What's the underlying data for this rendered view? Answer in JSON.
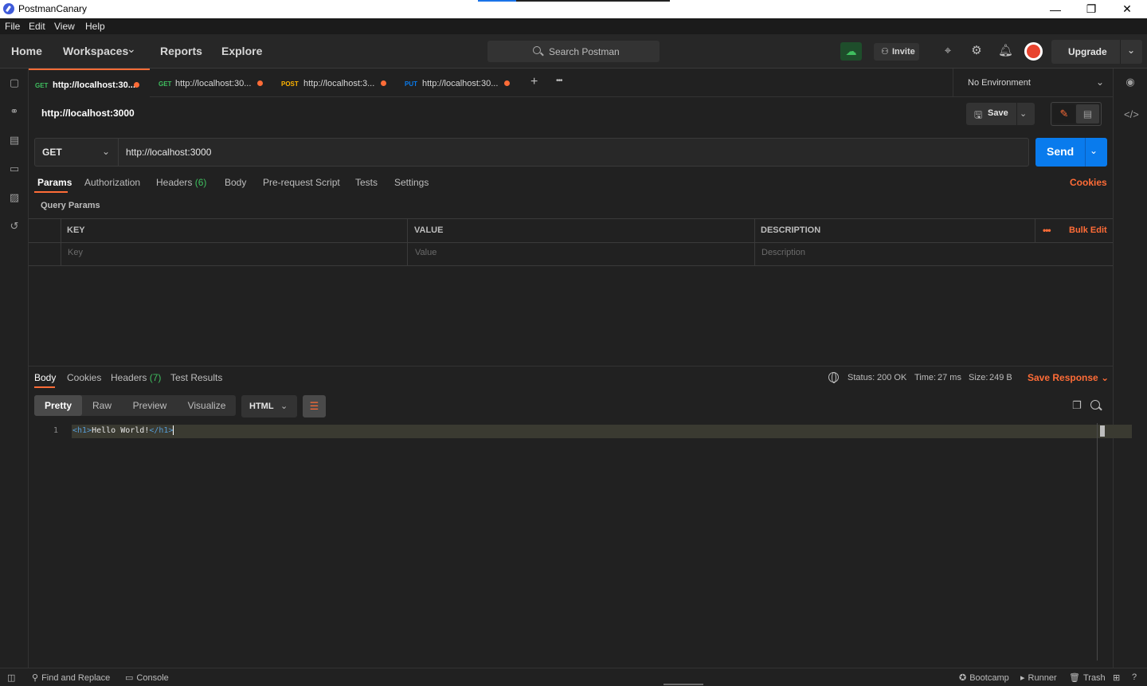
{
  "window": {
    "title": "PostmanCanary",
    "minimize": "—",
    "restore": "❐",
    "close": "✕"
  },
  "menu": [
    "File",
    "Edit",
    "View",
    "Help"
  ],
  "header": {
    "nav": [
      "Home",
      "Workspaces",
      "Reports",
      "Explore"
    ],
    "workspaces_chevron": "⌄",
    "search_placeholder": "Search Postman",
    "invite_label": "Invite",
    "upgrade_label": "Upgrade",
    "upgrade_chevron": "⌄"
  },
  "tabs": [
    {
      "method": "GET",
      "method_color": "#3fbf5f",
      "url": "http://localhost:30..."
    },
    {
      "method": "GET",
      "method_color": "#3fbf5f",
      "url": "http://localhost:30..."
    },
    {
      "method": "POST",
      "method_color": "#ffb400",
      "url": "http://localhost:3..."
    },
    {
      "method": "PUT",
      "method_color": "#097bed",
      "url": "http://localhost:30..."
    }
  ],
  "tab_actions": {
    "add": "+",
    "more": "•••"
  },
  "environment": {
    "selected": "No Environment",
    "chevron": "⌄"
  },
  "request": {
    "title": "http://localhost:3000",
    "save_label": "Save",
    "save_chevron": "⌄",
    "method": "GET",
    "method_chevron": "⌄",
    "url": "http://localhost:3000",
    "send_label": "Send",
    "send_chevron": "⌄",
    "tabs": [
      {
        "label": "Params",
        "count": ""
      },
      {
        "label": "Authorization",
        "count": ""
      },
      {
        "label": "Headers",
        "count": "(6)"
      },
      {
        "label": "Body",
        "count": ""
      },
      {
        "label": "Pre-request Script",
        "count": ""
      },
      {
        "label": "Tests",
        "count": ""
      },
      {
        "label": "Settings",
        "count": ""
      }
    ],
    "cookies_link": "Cookies",
    "query_params_label": "Query Params",
    "table": {
      "headers": [
        "KEY",
        "VALUE",
        "DESCRIPTION"
      ],
      "placeholders": [
        "Key",
        "Value",
        "Description"
      ],
      "more": "•••",
      "bulk_edit": "Bulk Edit"
    }
  },
  "response": {
    "tabs": [
      {
        "label": "Body",
        "count": ""
      },
      {
        "label": "Cookies",
        "count": ""
      },
      {
        "label": "Headers",
        "count": "(7)"
      },
      {
        "label": "Test Results",
        "count": ""
      }
    ],
    "status_label": "Status:",
    "status_value": "200 OK",
    "time_label": "Time:",
    "time_value": "27 ms",
    "size_label": "Size:",
    "size_value": "249 B",
    "save_response": "Save Response",
    "save_response_chevron": "⌄",
    "view_modes": [
      "Pretty",
      "Raw",
      "Preview",
      "Visualize"
    ],
    "language": "HTML",
    "language_chevron": "⌄",
    "code_line_number": "1",
    "code": {
      "open_tag": "<h1>",
      "text": "Hello World!",
      "close_tag_lt": "<",
      "close_tag_rest": "/h1>"
    }
  },
  "statusbar": {
    "find_replace": "Find and Replace",
    "console": "Console",
    "bootcamp": "Bootcamp",
    "runner": "Runner",
    "trash": "Trash"
  },
  "colors": {
    "accent": "#ff6c37",
    "send_blue": "#097bed",
    "success_green": "#3fbf5f"
  }
}
